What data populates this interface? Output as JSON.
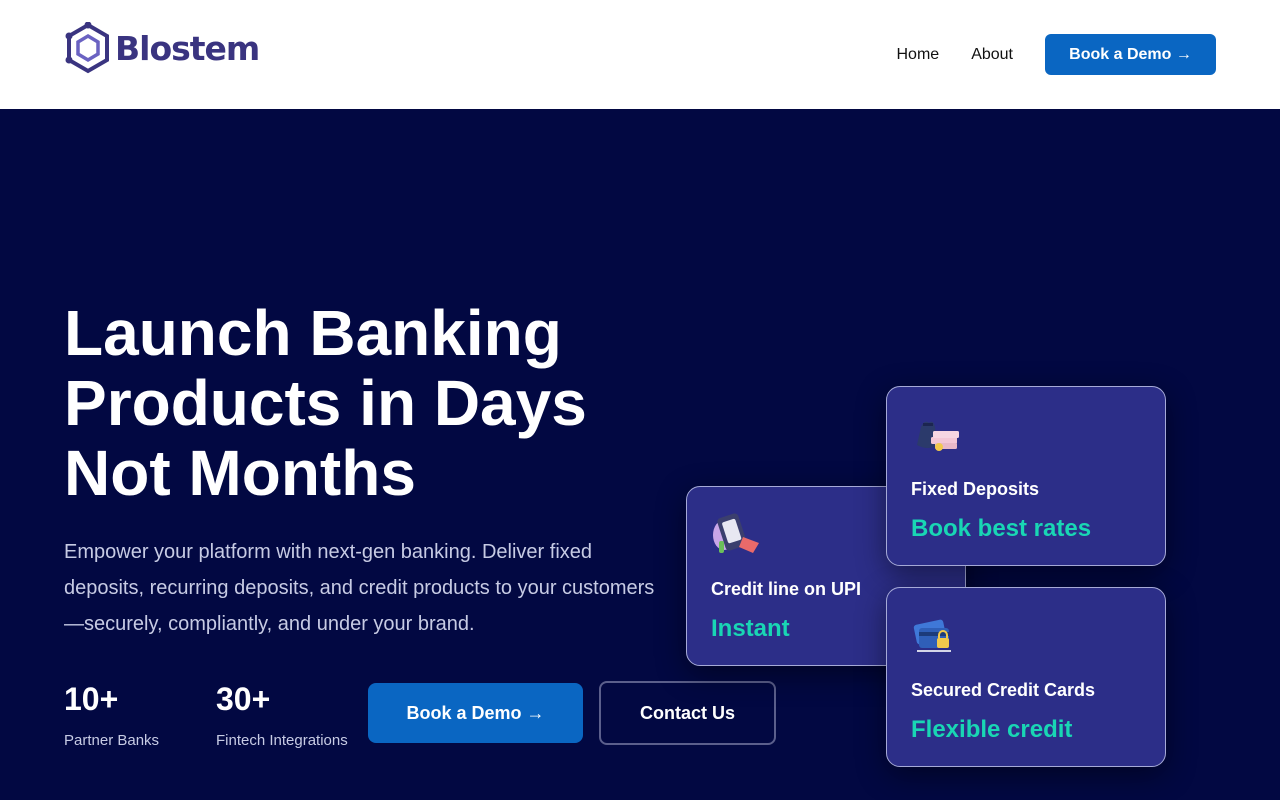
{
  "header": {
    "brand": "Blostem",
    "nav": [
      {
        "label": "Home"
      },
      {
        "label": "About"
      }
    ],
    "cta_label": "Book a Demo →"
  },
  "hero": {
    "title_lines": [
      "Launch Banking",
      "Products in Days",
      "Not Months"
    ],
    "description": "Empower your platform with next-gen banking. Deliver fixed deposits, recurring deposits, and credit products to your customers—securely, compliantly, and under your brand.",
    "stats": [
      {
        "value": "10+",
        "label": "Partner Banks"
      },
      {
        "value": "30+",
        "label": "Fintech Integrations"
      }
    ],
    "primary_button": "Book a Demo →",
    "secondary_button": "Contact Us"
  },
  "cards": [
    {
      "icon": "upi-phone-icon",
      "label": "Credit line on UPI",
      "value": "Instant"
    },
    {
      "icon": "money-bag-icon",
      "label": "Fixed Deposits",
      "value": "Book best rates"
    },
    {
      "icon": "credit-card-lock-icon",
      "label": "Secured Credit Cards",
      "value": "Flexible credit"
    }
  ],
  "colors": {
    "background": "#020842",
    "brand": "#3a3480",
    "accent": "#0a66c2",
    "card_bg": "#2c2e88",
    "highlight": "#19d6b4"
  }
}
